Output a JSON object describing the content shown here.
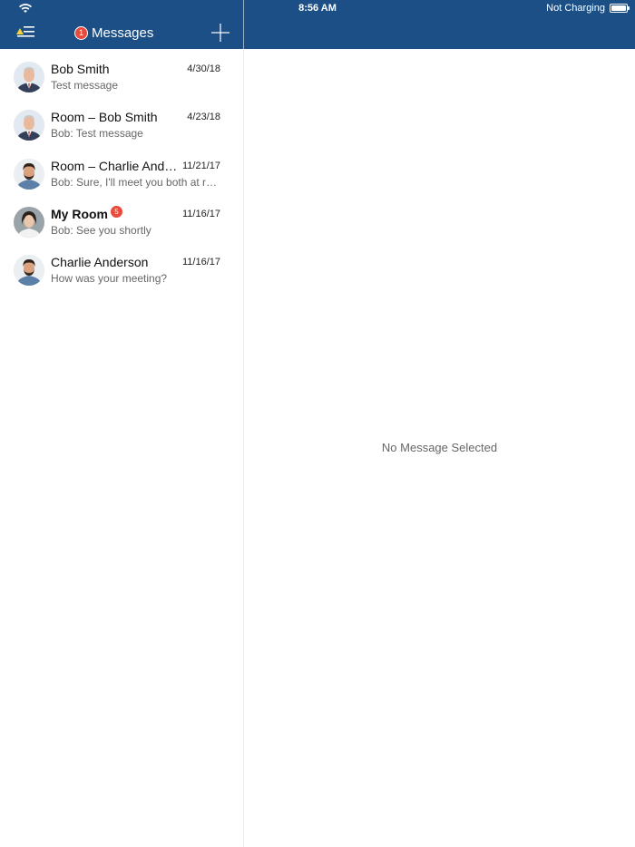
{
  "status_bar": {
    "time": "8:56 AM",
    "charging": "Not Charging",
    "battery_level": 1.0
  },
  "nav": {
    "title": "Messages",
    "unread_count": "1",
    "menu_icon": "menu-icon",
    "add_icon": "plus-icon"
  },
  "messages": [
    {
      "name": "Bob Smith",
      "date": "4/30/18",
      "preview": "Test message",
      "bold": false,
      "badge": "",
      "avatar": "bob"
    },
    {
      "name": "Room – Bob Smith",
      "date": "4/23/18",
      "preview": "Bob: Test message",
      "bold": false,
      "badge": "",
      "avatar": "bob"
    },
    {
      "name": "Room – Charlie Anderson",
      "date": "11/21/17",
      "preview": "Bob: Sure, I'll meet you both at reception",
      "bold": false,
      "badge": "",
      "avatar": "charlie"
    },
    {
      "name": "My Room",
      "date": "11/16/17",
      "preview": "Bob: See you shortly",
      "bold": true,
      "badge": "5",
      "avatar": "woman"
    },
    {
      "name": "Charlie Anderson",
      "date": "11/16/17",
      "preview": "How was your meeting?",
      "bold": false,
      "badge": "",
      "avatar": "charlie"
    }
  ],
  "detail": {
    "empty_text": "No Message Selected"
  },
  "colors": {
    "header": "#1b4f85",
    "badge": "#e84b3c"
  }
}
